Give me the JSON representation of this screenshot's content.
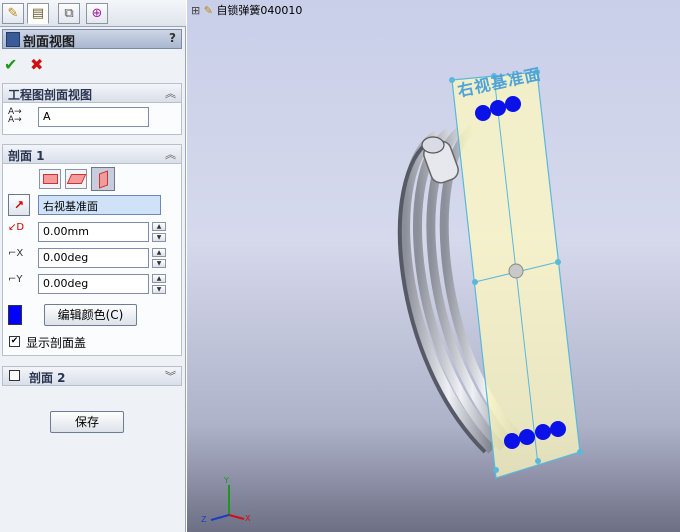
{
  "tabs": [
    {
      "icon": "feature-manager-icon"
    },
    {
      "icon": "property-manager-icon"
    },
    {
      "icon": "configuration-manager-icon"
    },
    {
      "icon": "dimxpert-icon"
    }
  ],
  "panel": {
    "title": "剖面视图",
    "help": "?",
    "ok_icon": "✔",
    "cancel_icon": "✖"
  },
  "section_view_group": {
    "header": "工程图剖面视图",
    "name_value": "A"
  },
  "section1": {
    "header": "剖面 1",
    "plane_value": "右视基准面",
    "distance_value": "0.00mm",
    "x_rotation_value": "0.00deg",
    "y_rotation_value": "0.00deg",
    "edit_color_label": "编辑颜色(C)",
    "color": "#0000ff",
    "show_cap_label": "显示剖面盖",
    "show_cap_checked": true
  },
  "section2": {
    "header": "剖面 2",
    "checked": false
  },
  "save_label": "保存",
  "viewport": {
    "tree_label": "自锁弹簧040010",
    "plane_label": "右视基准面",
    "triad": {
      "x": "X",
      "y": "Y",
      "z": "Z"
    }
  }
}
